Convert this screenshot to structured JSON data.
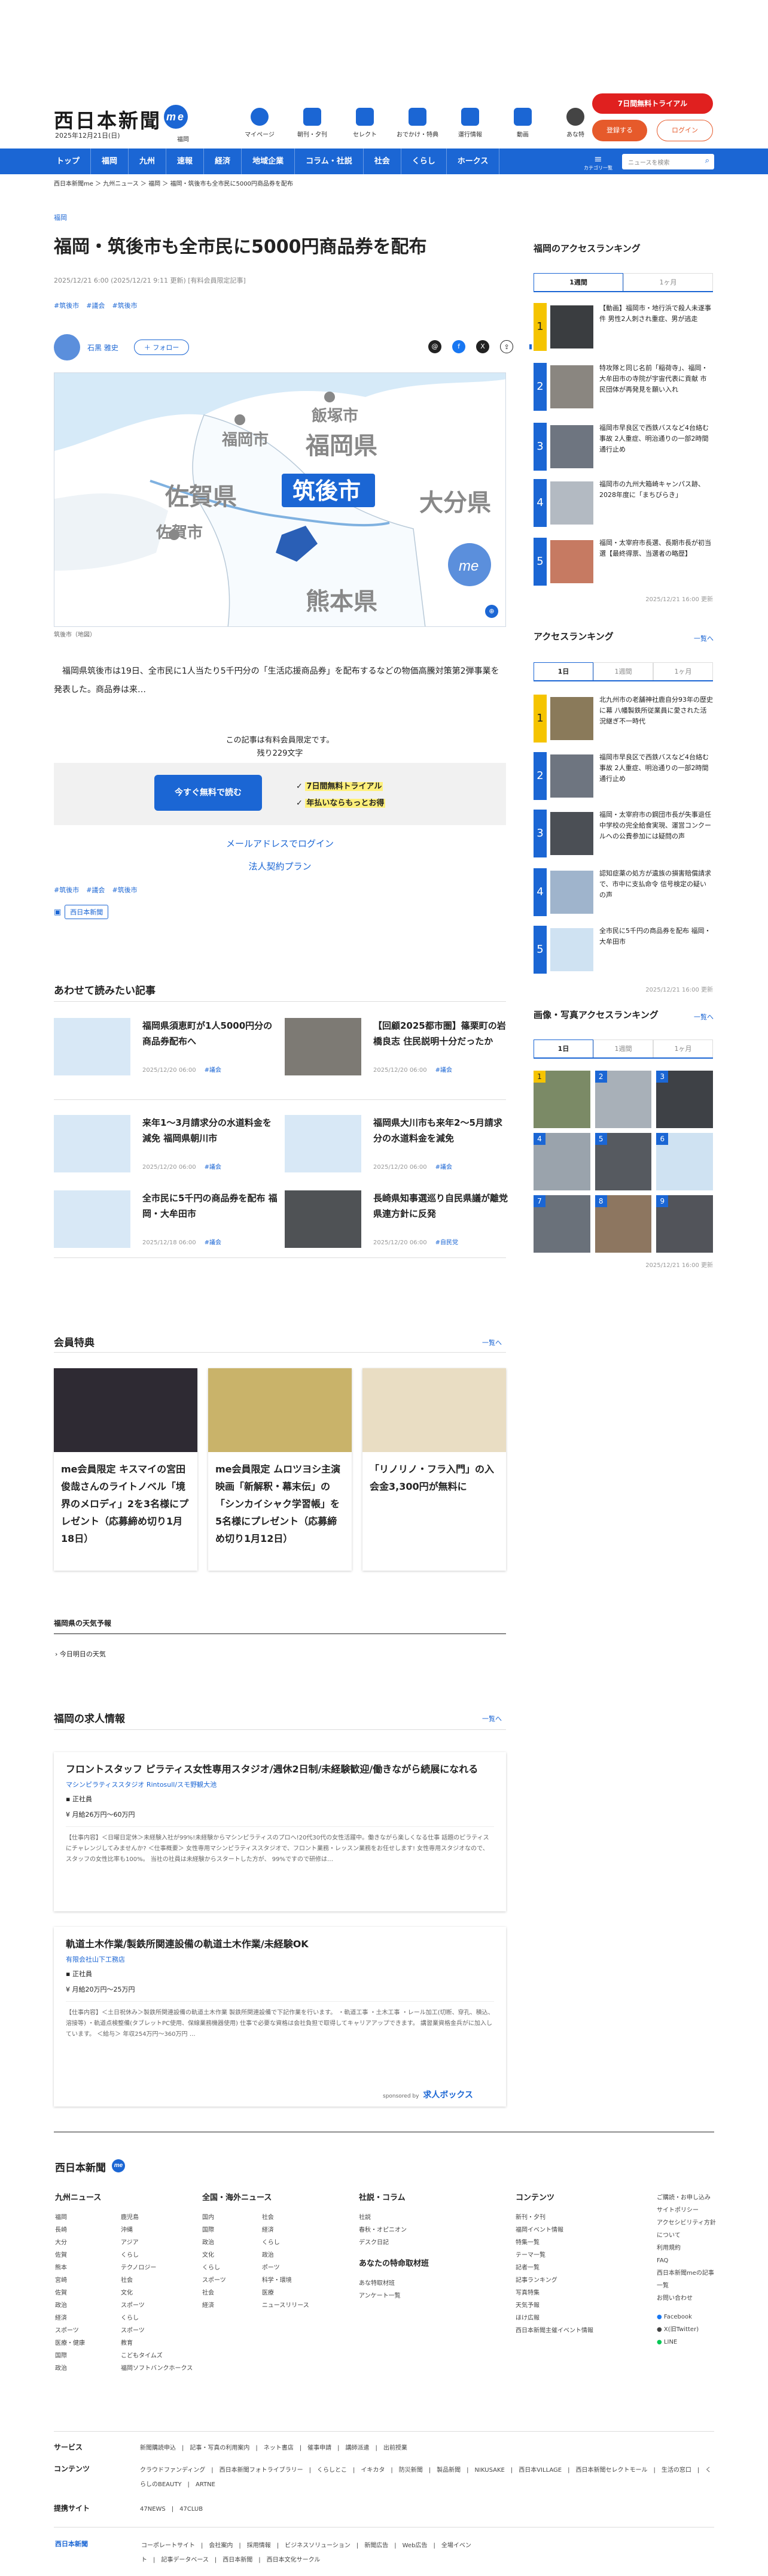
{
  "header": {
    "logo": "西日本新聞",
    "logo_me": "me",
    "date": "2025年12月21日(日)",
    "region": "福岡",
    "icons": [
      "マイページ",
      "朝刊・夕刊",
      "セレクト",
      "おでかけ・特典",
      "運行情報",
      "動画",
      "あな特"
    ],
    "trial": "7日間無料トライアル",
    "register": "登録する",
    "login": "ログイン"
  },
  "nav": {
    "items": [
      "トップ",
      "福岡",
      "九州",
      "速報",
      "経済",
      "地域企業",
      "コラム・社説",
      "社会",
      "くらし",
      "ホークス"
    ],
    "category": "カテゴリ一覧",
    "search_placeholder": "ニュースを検索"
  },
  "breadcrumb": "西日本新聞me ＞ 九州ニュース ＞ 福岡 ＞ 福岡・筑後市も全市民に5000円商品券を配布",
  "article": {
    "category": "福岡",
    "title": "福岡・筑後市も全市民に5000円商品券を配布",
    "meta": "2025/12/21 6:00 (2025/12/21 9:11 更新) [有料会員限定記事]",
    "tags": [
      "#筑後市",
      "#議会",
      "#筑後市"
    ],
    "author": "石黒 雅史",
    "follow": "＋ フォロー",
    "map_labels": {
      "fukuoka_city": "福岡市",
      "iizuka": "飯塚市",
      "fukuoka_pref": "福岡県",
      "saga": "佐賀県",
      "chikugo": "筑後市",
      "oita": "大分県",
      "saga_city": "佐賀市",
      "kumamoto": "熊本県",
      "enlarge": "拡大",
      "brand": "西日本新聞"
    },
    "caption": "筑後市（地図）",
    "lead": "福岡県筑後市は19日、全市民に1人当たり5千円分の「生活応援商品券」を配布するなどの物価高騰対策第2弾事業を発表した。商品券は来…",
    "note": "この記事は有料会員限定です。",
    "remaining": "残り229文字",
    "free_btn": "今すぐ無料で読む",
    "check1": "7日間無料トライアル",
    "check2": "年払いならもっとお得",
    "mail_login": "メールアドレスでログイン",
    "corp": "法人契約プラン",
    "tags2": [
      "#筑後市",
      "#議会",
      "#筑後市"
    ],
    "badge": "西日本新聞"
  },
  "related": {
    "heading": "あわせて読みたい記事",
    "items": [
      {
        "title": "福岡県須恵町が1人5000円分の商品券配布へ",
        "date": "2025/12/20 06:00",
        "tag": "#議会"
      },
      {
        "title": "【回顧2025都市圏】篠栗町の岩橋良志 住民説明十分だったか",
        "date": "2025/12/20 06:00",
        "tag": "#議会"
      },
      {
        "title": "来年1〜3月請求分の水道料金を減免 福岡県朝川市",
        "date": "2025/12/20 06:00",
        "tag": "#議会"
      },
      {
        "title": "福岡県大川市も来年2〜5月請求分の水道料金を減免",
        "date": "2025/12/20 06:00",
        "tag": "#議会"
      },
      {
        "title": "全市民に5千円の商品券を配布 福岡・大牟田市",
        "date": "2025/12/18 06:00",
        "tag": "#議会"
      },
      {
        "title": "長崎県知事選巡り自民県議が離党 県連方針に反発",
        "date": "2025/12/20 06:00",
        "tag": "#自民党"
      }
    ]
  },
  "side": {
    "ranking_title": "福岡のアクセスランキング",
    "tabs1": [
      "1週間",
      "1ヶ月"
    ],
    "ranking1": [
      "【動画】福岡市・地行浜で殺人未遂事件 男性2人刺され重症、男が逃走",
      "特攻隊と同じ名前「稲荷寺」、福岡・大牟田市の寺院が宇宙代表に貢献 市民団体が再発見を願い入れ",
      "福岡市早良区で西鉄バスなど4台絡む事故 2人重症、明治通りの一部2時間通行止め",
      "福岡市の九州大箱崎キャンパス跡、2028年度に「まちびらき」",
      "福岡・太宰府市長選、長期市長が初当選【最終得票、当選者の略歴】"
    ],
    "update1": "2025/12/21 16:00 更新",
    "access_title": "アクセスランキング",
    "access_more": "一覧へ",
    "tabs2": [
      "1日",
      "1週間",
      "1ヶ月"
    ],
    "ranking2": [
      "北九州市の老舗神社鹿自分93年の歴史に幕 八幡製鉄所従業員に愛された活況継ぎ不一時代",
      "福岡市早良区で西鉄バスなど4台絡む事故 2人重症、明治通りの一部2時間通行止め",
      "福岡・太宰府市の鋼団市長が失事退任 中学校の完全給食実現、運営コンクールへの公費参加には疑問の声",
      "認知症薬の処方が遺族の損害賠償請求で、市中に支払命令 信号検定の疑いの声",
      "全市民に5千円の商品券を配布 福岡・大牟田市"
    ],
    "update2": "2025/12/21 16:00 更新",
    "photo_title": "画像・写真アクセスランキング",
    "photo_more": "一覧へ",
    "tabs3": [
      "1日",
      "1週間",
      "1ヶ月"
    ],
    "update3": "2025/12/21 16:00 更新"
  },
  "member": {
    "heading": "会員特典",
    "more": "一覧へ",
    "cards": [
      "me会員限定 キスマイの宮田俊哉さんのライトノベル「境界のメロディ」2を3名様にプレゼント（応募締め切り1月18日）",
      "me会員限定 ムロツヨシ主演 映画「新解釈・幕末伝」の「シンカイシャク学習帳」を5名様にプレゼント（応募締め切り1月12日）",
      "「リノリノ・フラ入門」の入会金3,300円が無料に"
    ]
  },
  "weather": {
    "heading": "福岡県の天気予報",
    "link": "今日明日の天気"
  },
  "jobs": {
    "heading": "福岡の求人情報",
    "more": "一覧へ",
    "items": [
      {
        "title": "フロントスタッフ ピラティス女性専用スタジオ/週休2日制/未経験歓迎/働きながら続展になれる",
        "company": "マシンピラティススタジオ Rintosull/スモ野観大池",
        "type": "正社員",
        "salary": "月給26万円〜60万円",
        "desc": "【仕事内容】＜日曜日定休＞未経験入社が99%!未経験からマシンピラティスのプロへ!20代30代の女性活躍中。働きながら楽しくなる仕事 話題のピラティスにチャレンジしてみませんか? ＜仕事概要＞ 女性専用マシンピラティススタジオで、フロント業務・レッスン業務をお任せします! 女性専用スタジオなので、スタッフの女性比率も100%。 当社の社員は未経験からスタートした方が、 99%ですので研修は…"
      },
      {
        "title": "軌道土木作業/製鉄所関連設備の軌道土木作業/未経験OK",
        "company": "有限会社山下工務店",
        "type": "正社員",
        "salary": "月給20万円〜25万円",
        "desc": "【仕事内容】＜土日祝休み＞製鉄所関連設備の軌道土木作業 製鉄所関連設備で下記作業を行います。 ・軌道工事 ・土木工事 ・レール加工(切断、穿孔、積込、溶接等) ・軌道点検整備(タブレットPC使用、保線業務機器使用) 仕事で必要な資格は会社負担で取得してキャリアアップできます。 講習業資格金兵がに加入しています。 ＜給与＞ 年収254万円〜360万円 …"
      }
    ],
    "sponsor": "sponsored by",
    "sponsor_name": "求人ボックス"
  },
  "footer": {
    "logo": "西日本新聞",
    "col1_title": "九州ニュース",
    "col1": [
      "福岡",
      "長崎",
      "大分",
      "佐賀",
      "熊本",
      "宮崎",
      "佐賀",
      "政治",
      "経済",
      "スポーツ",
      "医療・健康",
      "国際",
      "政治"
    ],
    "col1b": [
      "鹿児島",
      "沖縄",
      "アジア",
      "くらし",
      "テクノロジー",
      "社会",
      "文化",
      "スポーツ",
      "くらし",
      "スポーツ",
      "教育",
      "こどもタイムズ",
      "福岡ソフトバンクホークス"
    ],
    "col2_title": "全国・海外ニュース",
    "col2": [
      "国内",
      "国際",
      "政治",
      "文化",
      "くらし",
      "スポーツ",
      "社会",
      "経済"
    ],
    "col2b": [
      "社会",
      "経済",
      "くらし",
      "政治",
      "ポーツ",
      "科学・環境",
      "医療",
      "ニュースリリース"
    ],
    "col3_title": "社説・コラム",
    "col3": [
      "社説",
      "春秋・オピニオン",
      "デスク日記"
    ],
    "col3b_title": "あなたの特命取材班",
    "col3b": [
      "あな特取材班",
      "アンケート一覧"
    ],
    "col4_title": "コンテンツ",
    "col4": [
      "新刊・夕刊",
      "福岡イベント情報",
      "特集一覧",
      "テーマ一覧",
      "記者一覧",
      "記事ランキング",
      "写真特集",
      "天気予報",
      "ほけ広報",
      "西日本新聞主催イベント情報"
    ],
    "col5": [
      "ご購読・お申し込み",
      "サイトポリシー",
      "アクセシビリティ方針について",
      "利用規約",
      "FAQ",
      "西日本新聞meの記事一覧",
      "お問い合わせ"
    ],
    "social": [
      "Facebook",
      "X(旧Twitter)",
      "LINE"
    ],
    "rows": [
      {
        "label": "サービス",
        "items": [
          "新聞購読申込",
          "記事・写真の利用案内",
          "ネット書店",
          "催事申請",
          "講師派遣",
          "出前授業"
        ]
      },
      {
        "label": "コンテンツ",
        "items": [
          "クラウドファンディング",
          "西日本新聞フォトライブラリー",
          "くらしとこ",
          "イキカタ",
          "防災新聞",
          "製品新聞",
          "NIKUSAKE",
          "西日本VILLAGE",
          "西日本新聞セレクトモール",
          "生活の窓口",
          "くらしのBEAUTY",
          "ARTNE"
        ]
      },
      {
        "label": "提携サイト",
        "items": [
          "47NEWS",
          "47CLUB"
        ]
      }
    ],
    "bottom": [
      "コーポレートサイト",
      "会社案内",
      "採用情報",
      "ビジネスソリューション",
      "新聞広告",
      "Web広告",
      "全場イベント",
      "記事データベース",
      "西日本新聞",
      "西日本文化サークル"
    ]
  }
}
